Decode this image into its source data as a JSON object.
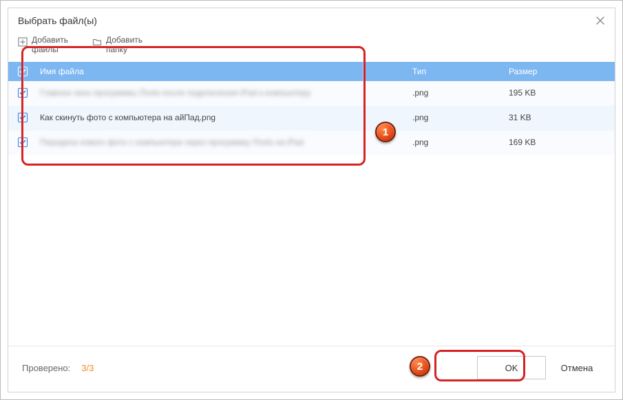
{
  "title": "Выбрать файл(ы)",
  "toolbar": {
    "add_files_label": "Добавить файлы",
    "add_folder_label": "Добавить папку"
  },
  "columns": {
    "name": "Имя файла",
    "type": "Тип",
    "size": "Размер"
  },
  "files": [
    {
      "name": "Главное окно программы iTools после подключения iPad к компьютеру",
      "ext": ".png",
      "size": "195 KB",
      "blurred": true
    },
    {
      "name": "Как скинуть фото с компьютера на айПад.png",
      "ext": ".png",
      "size": "31 KB",
      "blurred": false
    },
    {
      "name": "Передача нового фото с компьютера через программу iTools на iPad",
      "ext": ".png",
      "size": "169 KB",
      "blurred": true
    }
  ],
  "footer": {
    "status_label": "Проверено:",
    "status_count": "3/3",
    "ok": "OK",
    "cancel": "Отмена"
  },
  "annotations": {
    "1": "1",
    "2": "2"
  }
}
